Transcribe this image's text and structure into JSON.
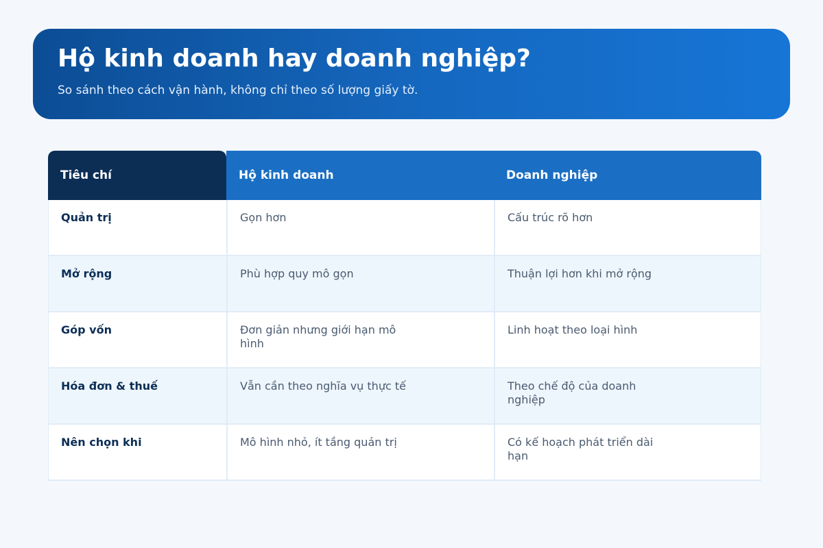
{
  "header": {
    "title": "Hộ kinh doanh hay doanh nghiệp?",
    "subtitle": "So sánh theo cách vận hành, không chỉ theo số lượng giấy tờ."
  },
  "table": {
    "columns": [
      "Tiêu chí",
      "Hộ kinh doanh",
      "Doanh nghiệp"
    ],
    "rows": [
      {
        "criterion": "Quản trị",
        "household": "Gọn hơn",
        "enterprise": "Cấu trúc rõ hơn"
      },
      {
        "criterion": "Mở rộng",
        "household": "Phù hợp quy mô gọn",
        "enterprise": "Thuận lợi hơn khi mở rộng"
      },
      {
        "criterion": "Góp vốn",
        "household": "Đơn giản nhưng giới hạn mô hình",
        "enterprise": "Linh hoạt theo loại hình"
      },
      {
        "criterion": "Hóa đơn & thuế",
        "household": "Vẫn cần theo nghĩa vụ thực tế",
        "enterprise": "Theo chế độ của doanh nghiệp"
      },
      {
        "criterion": "Nên chọn khi",
        "household": "Mô hình nhỏ, ít tầng quản trị",
        "enterprise": "Có kế hoạch phát triển dài hạn"
      }
    ]
  },
  "colors": {
    "header_gradient_start": "#0c4d95",
    "header_gradient_end": "#1675d6",
    "criterion_header": "#0c2e55",
    "column_header": "#1a6fc4",
    "row_alt": "#eef6fd",
    "page_background": "#f4f8fc"
  }
}
